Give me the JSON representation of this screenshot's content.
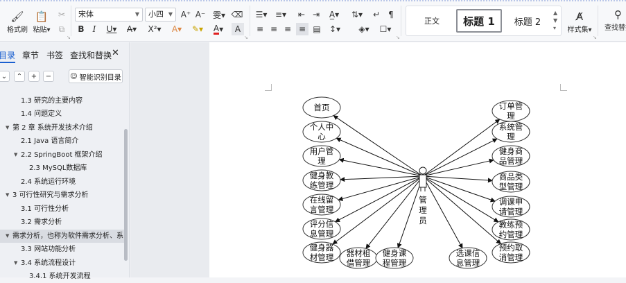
{
  "ribbon": {
    "format_painter": "格式刷",
    "paste": "粘贴",
    "font_name": "宋体",
    "font_size": "小四",
    "style_normal": "正文",
    "style_heading1": "标题 1",
    "style_heading2": "标题 2",
    "style_set": "样式集",
    "find_replace": "查找替换"
  },
  "nav": {
    "tabs": [
      "目录",
      "章节",
      "书签",
      "查找和替换"
    ],
    "smart_toc": "智能识别目录",
    "items": [
      {
        "label": "1.3  研究的主要内容",
        "toggle": ""
      },
      {
        "label": "1.4  问题定义",
        "toggle": ""
      },
      {
        "label": "第 2 章   系统开发技术介绍",
        "toggle": "▼"
      },
      {
        "label": "2.1 Java 语言简介",
        "toggle": ""
      },
      {
        "label": "2.2 SpringBoot 框架介绍",
        "toggle": "▼"
      },
      {
        "label": "2.3    MySQL数据库",
        "toggle": ""
      },
      {
        "label": "2.4    系统运行环境",
        "toggle": ""
      },
      {
        "label": "3  可行性研究与需求分析",
        "toggle": "▼"
      },
      {
        "label": "3.1 可行性分析",
        "toggle": ""
      },
      {
        "label": "3.2  需求分析",
        "toggle": ""
      },
      {
        "label": "需求分析，也称为软件需求分析、系…",
        "toggle": "▼"
      },
      {
        "label": "3.3 网站功能分析",
        "toggle": ""
      },
      {
        "label": "3.4 系统流程设计",
        "toggle": "▼"
      },
      {
        "label": "3.4.1  系统开发流程",
        "toggle": ""
      }
    ]
  },
  "diagram": {
    "actor": [
      "管",
      "理",
      "员"
    ],
    "left_nodes": [
      [
        "首页"
      ],
      [
        "个人中",
        "心"
      ],
      [
        "用户管",
        "理"
      ],
      [
        "健身教",
        "练管理"
      ],
      [
        "在线留",
        "言管理"
      ],
      [
        "评分信",
        "息管理"
      ],
      [
        "健身器",
        "材管理"
      ]
    ],
    "bottom_nodes": [
      [
        "器材租",
        "借管理"
      ],
      [
        "健身课",
        "程管理"
      ],
      [
        "选课信",
        "息管理"
      ]
    ],
    "right_nodes": [
      [
        "订单管",
        "理"
      ],
      [
        "系统管",
        "理"
      ],
      [
        "健身商",
        "品管理"
      ],
      [
        "商品类",
        "型管理"
      ],
      [
        "调课申",
        "请管理"
      ],
      [
        "教练预",
        "约管理"
      ],
      [
        "预约取",
        "消管理"
      ]
    ]
  }
}
